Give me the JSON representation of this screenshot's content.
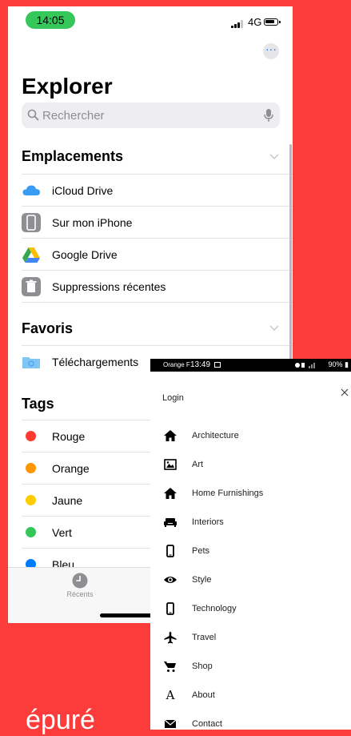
{
  "ios": {
    "time": "14:05",
    "network": "4G",
    "title": "Explorer",
    "search_placeholder": "Rechercher",
    "locations_header": "Emplacements",
    "locations": [
      {
        "label": "iCloud Drive",
        "icon": "icloud-icon"
      },
      {
        "label": "Sur mon iPhone",
        "icon": "iphone-icon"
      },
      {
        "label": "Google Drive",
        "icon": "google-drive-icon"
      },
      {
        "label": "Suppressions récentes",
        "icon": "trash-icon"
      }
    ],
    "favorites_header": "Favoris",
    "favorites": [
      {
        "label": "Téléchargements",
        "icon": "downloads-folder-icon"
      }
    ],
    "tags_header": "Tags",
    "tags": [
      {
        "label": "Rouge",
        "color": "#ff3b30"
      },
      {
        "label": "Orange",
        "color": "#ff9500"
      },
      {
        "label": "Jaune",
        "color": "#ffcc00"
      },
      {
        "label": "Vert",
        "color": "#34c759"
      },
      {
        "label": "Bleu",
        "color": "#007aff"
      }
    ],
    "tab_recents": "Récents"
  },
  "android": {
    "operator": "Orange F",
    "time": "13:49",
    "battery": "90%",
    "login": "Login",
    "menu": [
      {
        "label": "Architecture",
        "icon": "home-icon"
      },
      {
        "label": "Art",
        "icon": "image-icon"
      },
      {
        "label": "Home Furnishings",
        "icon": "home-icon"
      },
      {
        "label": "Interiors",
        "icon": "sofa-icon"
      },
      {
        "label": "Pets",
        "icon": "phone-icon"
      },
      {
        "label": "Style",
        "icon": "eye-icon"
      },
      {
        "label": "Technology",
        "icon": "phone-icon"
      },
      {
        "label": "Travel",
        "icon": "airplane-icon"
      },
      {
        "label": "Shop",
        "icon": "cart-icon"
      },
      {
        "label": "About",
        "icon": "letter-a-icon"
      },
      {
        "label": "Contact",
        "icon": "mail-icon"
      }
    ]
  },
  "background_text": "épuré",
  "colors": {
    "background": "#fc3c3b",
    "time_pill": "#35c759",
    "ios_accent": "#007aff"
  }
}
